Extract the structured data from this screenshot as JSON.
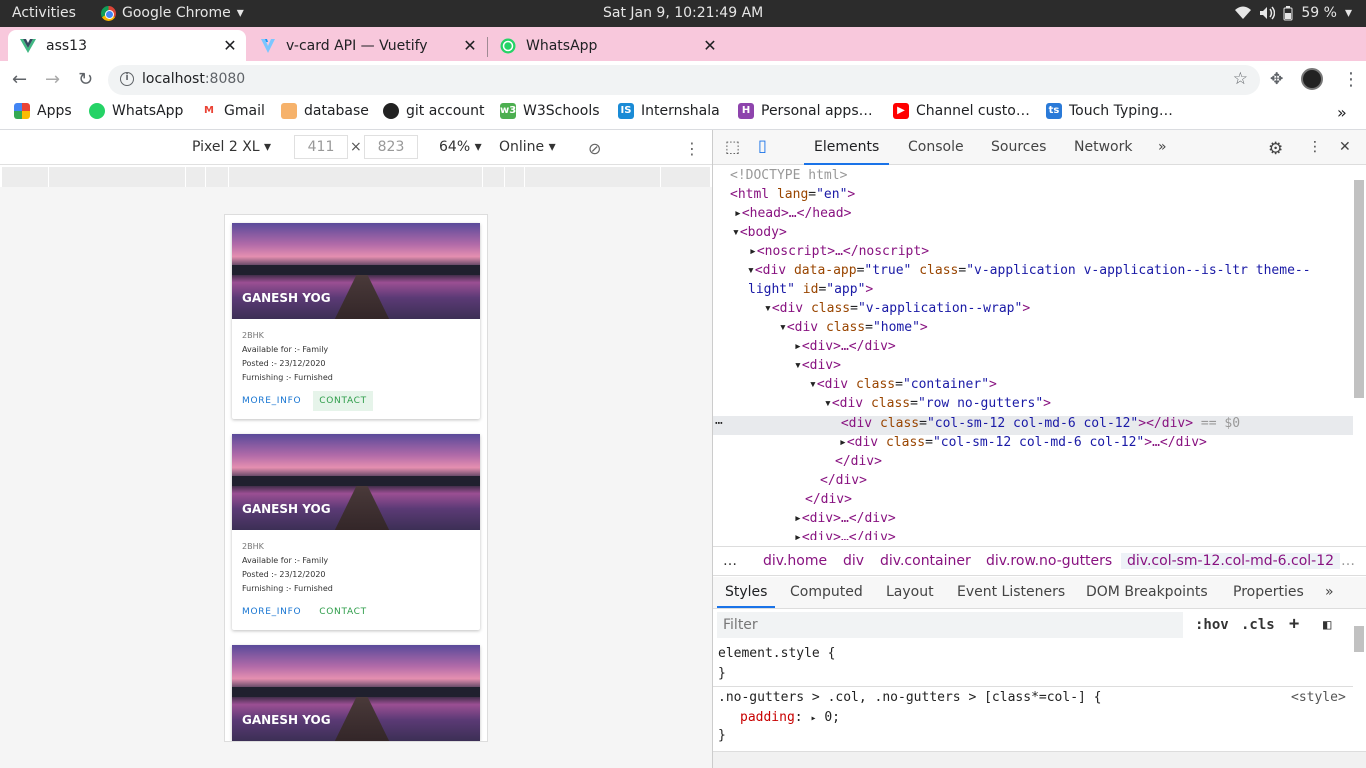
{
  "os": {
    "activities": "Activities",
    "app_name": "Google Chrome",
    "clock": "Sat Jan  9, 10:21:49 AM",
    "battery": "59 %"
  },
  "tabs": [
    {
      "title": "ass13",
      "icon": "vue-icon"
    },
    {
      "title": "v-card API — Vuetify",
      "icon": "vuetify-icon"
    },
    {
      "title": "WhatsApp",
      "icon": "whatsapp-icon"
    }
  ],
  "address": {
    "host": "localhost",
    "port": ":8080"
  },
  "bookmarks": [
    "Apps",
    "WhatsApp",
    "Gmail",
    "database",
    "git account",
    "W3Schools",
    "Internshala",
    "Personal apps…",
    "Channel custo…",
    "Touch Typing…"
  ],
  "device_toolbar": {
    "device": "Pixel 2 XL",
    "width": "411",
    "height": "823",
    "zoom": "64%",
    "network": "Online"
  },
  "cards": [
    {
      "name": "GANESH YOG",
      "type": "2BHK",
      "available": "Available for :- Family",
      "posted": "Posted :- 23/12/2020",
      "furnishing": "Furnishing :- Furnished",
      "more": "MORE_INFO",
      "contact": "CONTACT"
    },
    {
      "name": "GANESH YOG",
      "type": "2BHK",
      "available": "Available for :- Family",
      "posted": "Posted :- 23/12/2020",
      "furnishing": "Furnishing :- Furnished",
      "more": "MORE_INFO",
      "contact": "CONTACT"
    },
    {
      "name": "GANESH YOG"
    }
  ],
  "devtools": {
    "tabs": [
      "Elements",
      "Console",
      "Sources",
      "Network"
    ],
    "dom": {
      "doctype": "<!DOCTYPE html>",
      "html": "html",
      "lang_attr": "lang",
      "lang_val": "\"en\"",
      "head": "<head>…</head>",
      "body": "<body>",
      "noscript": "<noscript>…</noscript>",
      "div_app_a": "div",
      "data_app": "data-app",
      "data_app_val": "\"true\"",
      "class_attr": "class",
      "app_class_1": "\"v-application v-application--is-ltr theme--",
      "app_class_2": "light\"",
      "id_attr": "id",
      "id_val": "\"app\"",
      "wrap": "\"v-application--wrap\"",
      "home": "\"home\"",
      "collapsed_div": "<div>…</div>",
      "div_open": "<div>",
      "container": "\"container\"",
      "row": "\"row no-gutters\"",
      "col": "\"col-sm-12 col-md-6 col-12\"",
      "close_div": "</div>",
      "selected_suffix": "== $0",
      "ellipsis_div": "<div>…</div>"
    },
    "breadcrumb": [
      "div.home",
      "div",
      "div.container",
      "div.row.no-gutters",
      "div.col-sm-12.col-md-6.col-12"
    ],
    "style_tabs": [
      "Styles",
      "Computed",
      "Layout",
      "Event Listeners",
      "DOM Breakpoints",
      "Properties"
    ],
    "filter_placeholder": "Filter",
    "hov": ":hov",
    "cls": ".cls",
    "styles": {
      "element_style": "element.style {",
      "close": "}",
      "rule": ".no-gutters > .col, .no-gutters > [class*=col-] {",
      "source": "<style>",
      "prop": "padding",
      "val": "0;"
    }
  }
}
